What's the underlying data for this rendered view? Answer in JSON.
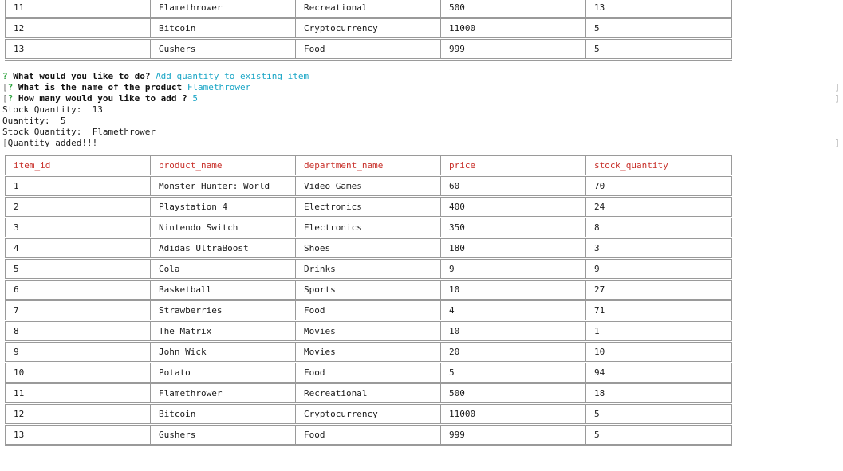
{
  "top_table": {
    "rows": [
      [
        "11",
        "Flamethrower",
        "Recreational",
        "500",
        "13"
      ],
      [
        "12",
        "Bitcoin",
        "Cryptocurrency",
        "11000",
        "5"
      ],
      [
        "13",
        "Gushers",
        "Food",
        "999",
        "5"
      ]
    ]
  },
  "console": {
    "prompt_marker": "?",
    "q1_text": "What would you like to do?",
    "q1_answer": "Add quantity to existing item",
    "q2_text": "What is the name of the product",
    "q2_answer": "Flamethrower",
    "q3_text": "How many would you like to add ?",
    "q3_answer": "5",
    "out1": "Stock Quantity:  13",
    "out2": "Quantity:  5",
    "out3": "Stock Quantity:  Flamethrower",
    "out4": "Quantity added!!!"
  },
  "bottom_table": {
    "headers": [
      "item_id",
      "product_name",
      "department_name",
      "price",
      "stock_quantity"
    ],
    "rows": [
      [
        "1",
        "Monster Hunter: World",
        "Video Games",
        "60",
        "70"
      ],
      [
        "2",
        "Playstation 4",
        "Electronics",
        "400",
        "24"
      ],
      [
        "3",
        "Nintendo Switch",
        "Electronics",
        "350",
        "8"
      ],
      [
        "4",
        "Adidas UltraBoost",
        "Shoes",
        "180",
        "3"
      ],
      [
        "5",
        "Cola",
        "Drinks",
        "9",
        "9"
      ],
      [
        "6",
        "Basketball",
        "Sports",
        "10",
        "27"
      ],
      [
        "7",
        "Strawberries",
        "Food",
        "4",
        "71"
      ],
      [
        "8",
        "The Matrix",
        "Movies",
        "10",
        "1"
      ],
      [
        "9",
        "John Wick",
        "Movies",
        "20",
        "10"
      ],
      [
        "10",
        "Potato",
        "Food",
        "5",
        "94"
      ],
      [
        "11",
        "Flamethrower",
        "Recreational",
        "500",
        "18"
      ],
      [
        "12",
        "Bitcoin",
        "Cryptocurrency",
        "11000",
        "5"
      ],
      [
        "13",
        "Gushers",
        "Food",
        "999",
        "5"
      ]
    ]
  },
  "colors": {
    "header_text": "#c8302a",
    "prompt_marker": "#2aa13b",
    "answer_text": "#1ba6c6",
    "border": "#9a9a9a"
  }
}
